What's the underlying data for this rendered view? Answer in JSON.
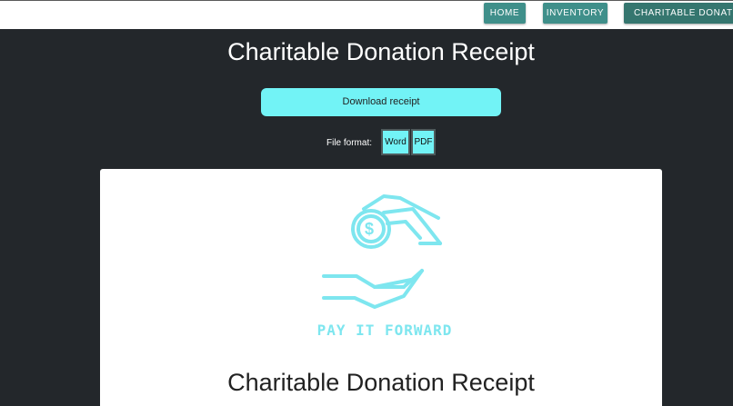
{
  "nav": {
    "home": "HOME",
    "inventory": "INVENTORY",
    "charitable": "CHARITABLE DONATION R"
  },
  "page": {
    "title": "Charitable Donation Receipt"
  },
  "download": {
    "label": "Download receipt"
  },
  "format": {
    "label": "File format:",
    "word": "Word",
    "pdf": "PDF"
  },
  "receipt": {
    "logo_text": "PAY IT FORWARD",
    "title": "Charitable Donation Receipt"
  },
  "colors": {
    "background": "#23272b",
    "nav_button": "#3f8f8a",
    "accent": "#72f3f6",
    "logo": "#7ee6ef"
  },
  "icons": {
    "logo": "hand-giving-coin-icon"
  }
}
